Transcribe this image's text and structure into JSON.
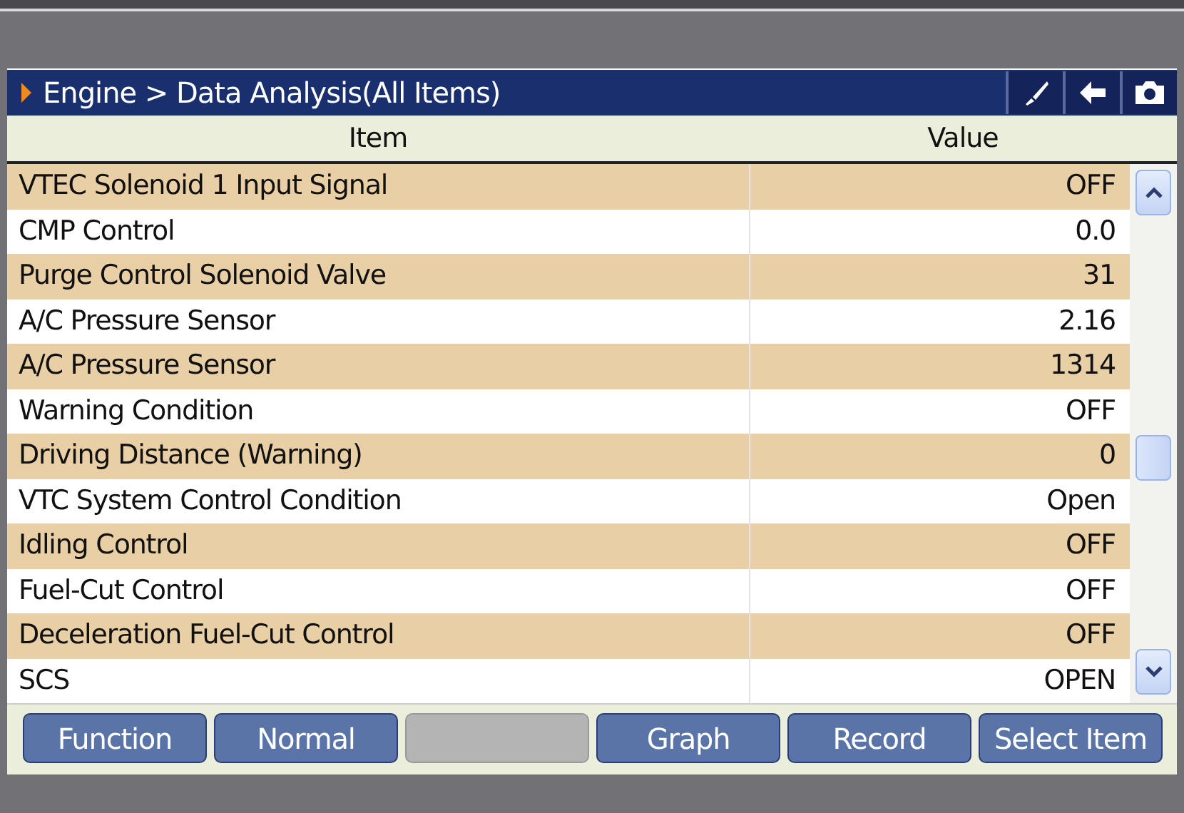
{
  "header": {
    "breadcrumb": "Engine > Data Analysis(All Items)"
  },
  "table": {
    "columns": [
      "Item",
      "Value"
    ],
    "rows": [
      {
        "item": "VTEC Solenoid 1 Input Signal",
        "value": "OFF"
      },
      {
        "item": "CMP Control",
        "value": "0.0"
      },
      {
        "item": "Purge Control Solenoid Valve",
        "value": "31"
      },
      {
        "item": "A/C Pressure Sensor",
        "value": "2.16"
      },
      {
        "item": "A/C Pressure Sensor",
        "value": "1314"
      },
      {
        "item": "Warning Condition",
        "value": "OFF"
      },
      {
        "item": "Driving Distance (Warning)",
        "value": "0"
      },
      {
        "item": "VTC System Control Condition",
        "value": "Open"
      },
      {
        "item": "Idling Control",
        "value": "OFF"
      },
      {
        "item": "Fuel-Cut Control",
        "value": "OFF"
      },
      {
        "item": "Deceleration Fuel-Cut Control",
        "value": "OFF"
      },
      {
        "item": "SCS",
        "value": "OPEN"
      }
    ]
  },
  "buttons": [
    {
      "label": "Function",
      "disabled": false
    },
    {
      "label": "Normal",
      "disabled": false
    },
    {
      "disabled": true
    },
    {
      "label": "Graph",
      "disabled": false
    },
    {
      "label": "Record",
      "disabled": false
    },
    {
      "label": "Select Item",
      "disabled": false
    }
  ]
}
